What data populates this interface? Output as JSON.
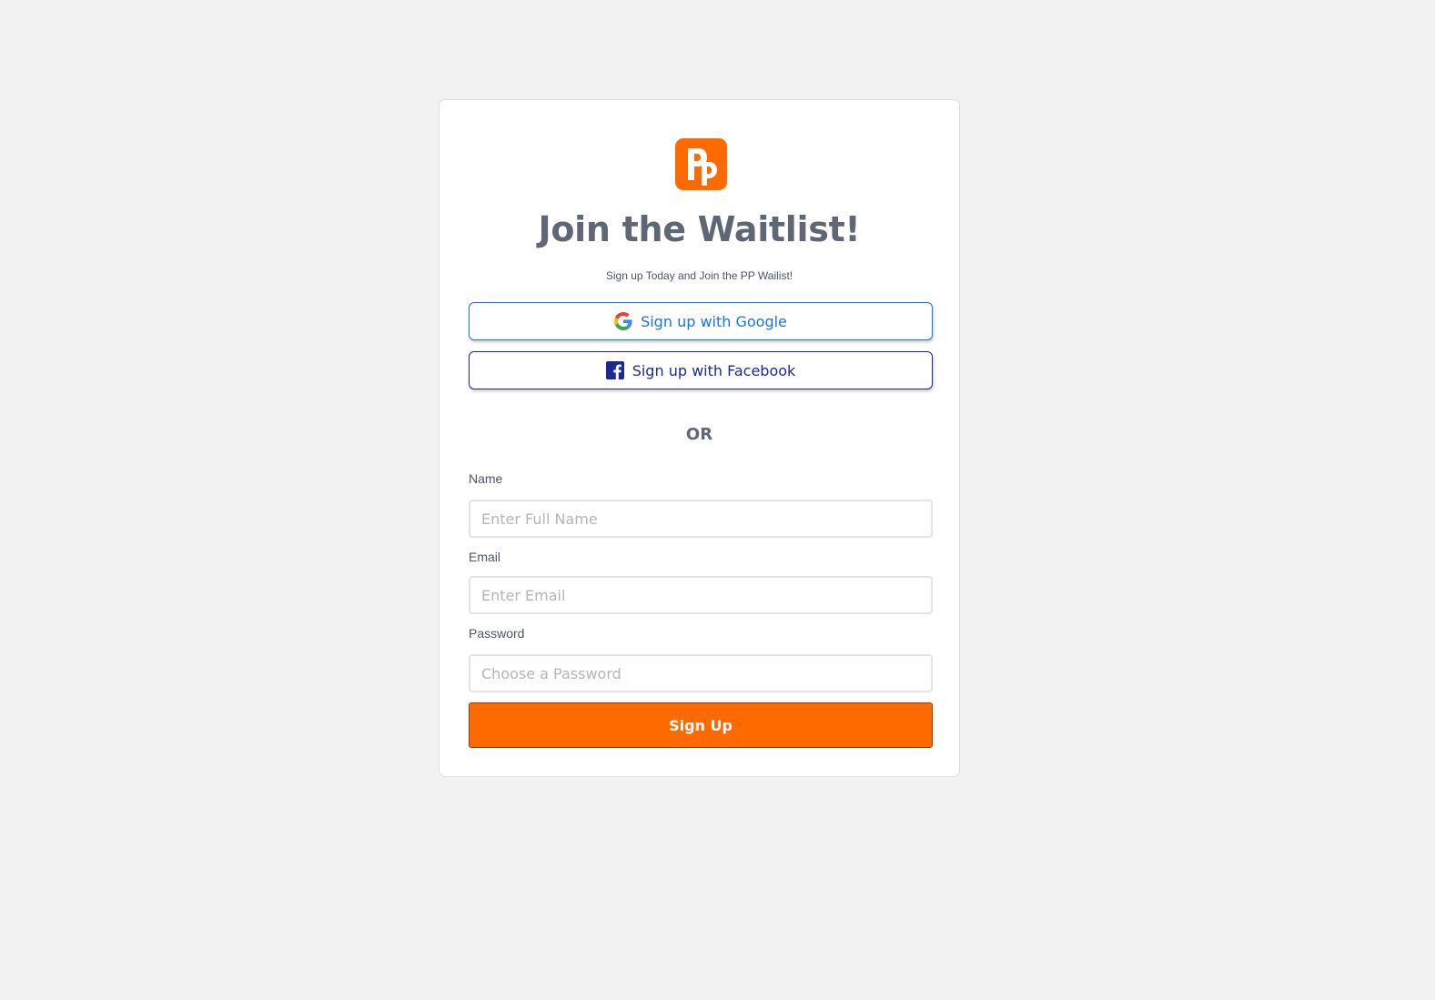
{
  "brand": {
    "logo_text": "Pp",
    "accent_color": "#ff6a00"
  },
  "header": {
    "title": "Join the Waitlist!",
    "subtitle": "Sign up Today and Join the PP Wailist!"
  },
  "social": {
    "google_label": "Sign up with Google",
    "google_icon": "google-g-icon",
    "facebook_label": "Sign up with Facebook",
    "facebook_icon": "facebook-f-icon"
  },
  "divider": {
    "text": "OR"
  },
  "form": {
    "name": {
      "label": "Name",
      "placeholder": "Enter Full Name",
      "value": ""
    },
    "email": {
      "label": "Email",
      "placeholder": "Enter Email",
      "value": ""
    },
    "password": {
      "label": "Password",
      "placeholder": "Choose a Password",
      "value": ""
    },
    "submit_label": "Sign Up"
  }
}
